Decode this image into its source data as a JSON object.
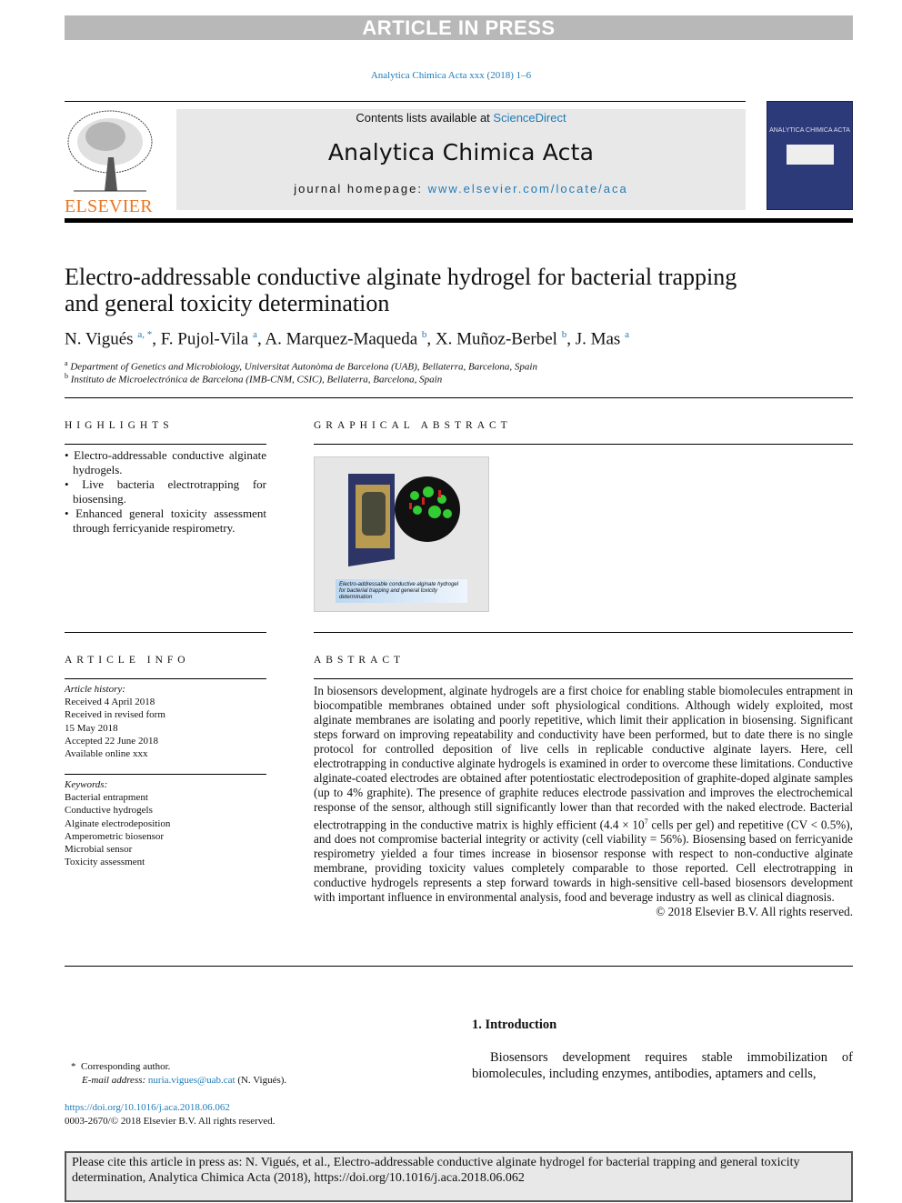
{
  "banner": "ARTICLE IN PRESS",
  "journal_ref": "Analytica Chimica Acta xxx (2018) 1–6",
  "header": {
    "contents_prefix": "Contents lists available at ",
    "contents_link": "ScienceDirect",
    "journal_title": "Analytica Chimica Acta",
    "homepage_prefix": "journal homepage: ",
    "homepage_link": "www.elsevier.com/locate/aca",
    "publisher_logo": "ELSEVIER",
    "cover_title": "ANALYTICA CHIMICA ACTA"
  },
  "article": {
    "title": "Electro-addressable conductive alginate hydrogel for bacterial trapping and general toxicity determination",
    "authors": [
      {
        "name": "N. Vigués",
        "sup": "a, *"
      },
      {
        "name": "F. Pujol-Vila",
        "sup": "a"
      },
      {
        "name": "A. Marquez-Maqueda",
        "sup": "b"
      },
      {
        "name": "X. Muñoz-Berbel",
        "sup": "b"
      },
      {
        "name": "J. Mas",
        "sup": "a"
      }
    ],
    "affiliations": [
      {
        "sup": "a",
        "text": "Department of Genetics and Microbiology, Universitat Autonòma de Barcelona (UAB), Bellaterra, Barcelona, Spain"
      },
      {
        "sup": "b",
        "text": "Instituto de Microelectrónica de Barcelona (IMB-CNM, CSIC), Bellaterra, Barcelona, Spain"
      }
    ]
  },
  "highlights": {
    "heading": "HIGHLIGHTS",
    "items": [
      "Electro-addressable conductive alginate hydrogels.",
      "Live bacteria electrotrapping for biosensing.",
      "Enhanced general toxicity assessment through ferricyanide respirometry."
    ]
  },
  "graphical_abstract": {
    "heading": "GRAPHICAL ABSTRACT",
    "caption": "Electro-addressable conductive alginate hydrogel for bacterial trapping and general toxicity determination"
  },
  "article_info": {
    "heading": "ARTICLE INFO",
    "history_label": "Article history:",
    "history": [
      "Received 4 April 2018",
      "Received in revised form",
      "15 May 2018",
      "Accepted 22 June 2018",
      "Available online xxx"
    ],
    "keywords_label": "Keywords:",
    "keywords": [
      "Bacterial entrapment",
      "Conductive hydrogels",
      "Alginate electrodeposition",
      "Amperometric biosensor",
      "Microbial sensor",
      "Toxicity assessment"
    ]
  },
  "abstract": {
    "heading": "ABSTRACT",
    "text_1": "In biosensors development, alginate hydrogels are a first choice for enabling stable biomolecules entrapment in biocompatible membranes obtained under soft physiological conditions. Although widely exploited, most alginate membranes are isolating and poorly repetitive, which limit their application in biosensing. Significant steps forward on improving repeatability and conductivity have been performed, but to date there is no single protocol for controlled deposition of live cells in replicable conductive alginate layers. Here, cell electrotrapping in conductive alginate hydrogels is examined in order to overcome these limitations. Conductive alginate-coated electrodes are obtained after potentiostatic electrodeposition of graphite-doped alginate samples (up to 4% graphite). The presence of graphite reduces electrode passivation and improves the electrochemical response of the sensor, although still significantly lower than that recorded with the naked electrode. Bacterial electrotrapping in the conductive matrix is highly efficient (4.4 × 10",
    "exp": "7",
    "text_2": " cells per gel) and repetitive (CV < 0.5%), and does not compromise bacterial integrity or activity (cell viability = 56%). Biosensing based on ferricyanide respirometry yielded a four times increase in biosensor response with respect to non-conductive alginate membrane, providing toxicity values completely comparable to those reported. Cell electrotrapping in conductive hydrogels represents a step forward towards in high-sensitive cell-based biosensors development with important influence in environmental analysis, food and beverage industry as well as clinical diagnosis.",
    "copyright": "© 2018 Elsevier B.V. All rights reserved."
  },
  "intro": {
    "heading": "1.  Introduction",
    "text": "Biosensors development requires stable immobilization of biomolecules, including enzymes, antibodies, aptamers and cells,"
  },
  "footnote": {
    "star": "*",
    "corresponding": "Corresponding author.",
    "email_label": "E-mail address: ",
    "email": "nuria.vigues@uab.cat",
    "email_suffix": " (N. Vigués).",
    "doi": "https://doi.org/10.1016/j.aca.2018.06.062",
    "issn": "0003-2670/© 2018 Elsevier B.V. All rights reserved."
  },
  "citation": "Please cite this article in press as: N. Vigués, et al., Electro-addressable conductive alginate hydrogel for bacterial trapping and general toxicity determination, Analytica Chimica Acta (2018), https://doi.org/10.1016/j.aca.2018.06.062",
  "colors": {
    "link": "#1f7bb7",
    "banner": "#b8b8b8",
    "elsevier": "#e87722",
    "cover": "#2d3a7a"
  }
}
